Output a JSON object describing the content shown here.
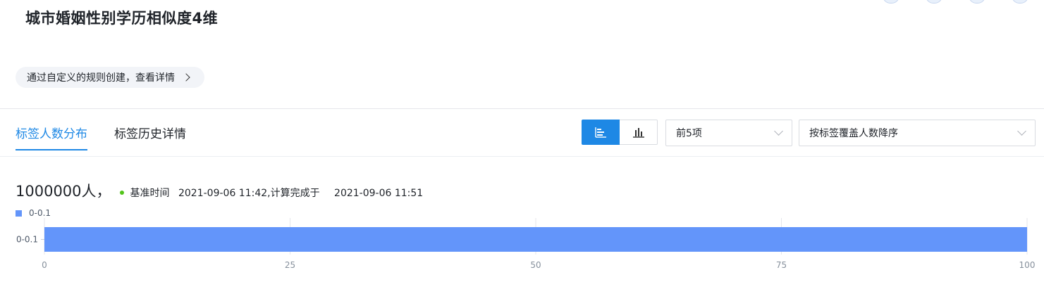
{
  "header": {
    "title": "城市婚姻性别学历相似度4维",
    "rule_link": "通过自定义的规则创建，查看详情"
  },
  "tabs": [
    {
      "label": "标签人数分布",
      "active": true
    },
    {
      "label": "标签历史详情",
      "active": false
    }
  ],
  "toolbar": {
    "view_modes": [
      {
        "icon": "horizontal-bar-chart-icon",
        "active": true
      },
      {
        "icon": "vertical-bar-chart-icon",
        "active": false
      }
    ],
    "top_n": "前5项",
    "sort": "按标签覆盖人数降序"
  },
  "summary": {
    "count": "1000000人",
    "separator": "，",
    "base_time_label": "基准时间",
    "base_time": "2021-09-06 11:42,计算完成于",
    "completed_time": "2021-09-06 11:51",
    "status_color": "#52c41a"
  },
  "chart_data": {
    "type": "bar",
    "orientation": "horizontal",
    "categories": [
      "0-0.1"
    ],
    "series": [
      {
        "name": "0-0.1",
        "values": [
          100
        ]
      }
    ],
    "xlim": [
      0,
      100
    ],
    "xticks": [
      "0",
      "25",
      "50",
      "75",
      "100"
    ],
    "grid": true,
    "legend": "top-left",
    "color": "#6395fa"
  }
}
